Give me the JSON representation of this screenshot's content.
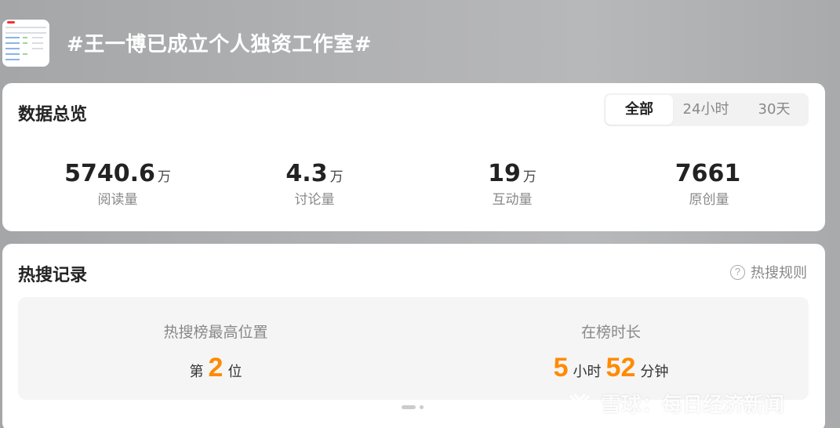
{
  "header": {
    "title": "#王一博已成立个人独资工作室#",
    "thumbnail_icon": "spreadsheet-thumbnail-icon"
  },
  "overview": {
    "title": "数据总览",
    "tabs": [
      {
        "label": "全部",
        "active": true
      },
      {
        "label": "24小时",
        "active": false
      },
      {
        "label": "30天",
        "active": false
      }
    ],
    "stats": [
      {
        "value": "5740.6",
        "unit": "万",
        "label": "阅读量"
      },
      {
        "value": "4.3",
        "unit": "万",
        "label": "讨论量"
      },
      {
        "value": "19",
        "unit": "万",
        "label": "互动量"
      },
      {
        "value": "7661",
        "unit": "",
        "label": "原创量"
      }
    ]
  },
  "hot_search": {
    "title": "热搜记录",
    "rules_label": "热搜规则",
    "rules_icon": "question-circle-icon",
    "highest_position": {
      "label": "热搜榜最高位置",
      "prefix": "第",
      "value": "2",
      "suffix": "位"
    },
    "duration": {
      "label": "在榜时长",
      "hours": "5",
      "hours_unit": "小时",
      "minutes": "52",
      "minutes_unit": "分钟"
    },
    "pager": {
      "count": 2,
      "active_index": 0
    }
  },
  "watermark": {
    "text": "雪球：每日经济新闻",
    "icon": "snowball-logo-icon"
  },
  "colors": {
    "accent": "#ff8a00",
    "card_bg": "#ffffff",
    "inner_bg": "#f5f5f5",
    "muted_text": "#888888"
  }
}
